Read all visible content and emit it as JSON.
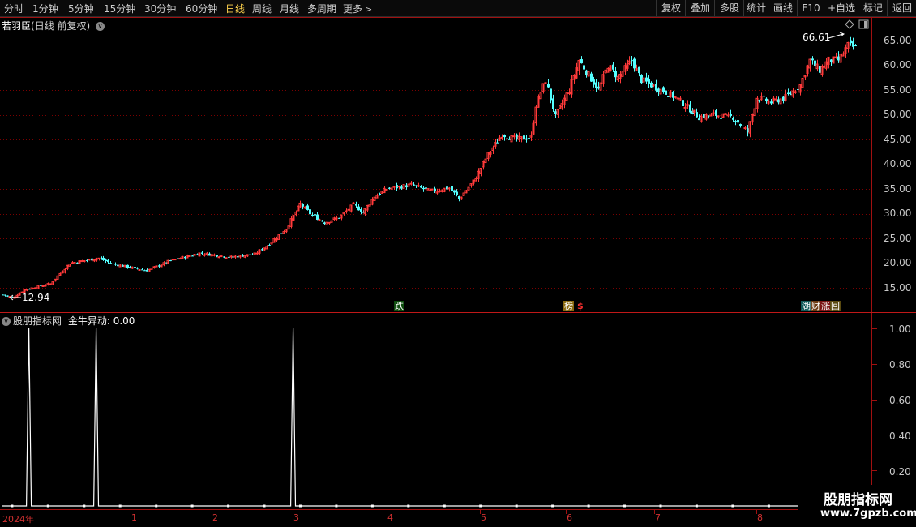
{
  "toolbar": {
    "timeframes": [
      "分时",
      "1分钟",
      "5分钟",
      "15分钟",
      "30分钟",
      "60分钟",
      "日线",
      "周线",
      "月线",
      "多周期",
      "更多"
    ],
    "active_timeframe": "日线",
    "buttons": [
      "复权",
      "叠加",
      "多股",
      "统计",
      "画线",
      "F10",
      "+自选",
      "返回"
    ]
  },
  "main_chart": {
    "stock_name": "若羽臣",
    "period_label": "(日线 前复权)",
    "y_ticks": [
      "65.00",
      "60.00",
      "55.00",
      "50.00",
      "45.00",
      "40.00",
      "35.00",
      "30.00",
      "25.00",
      "20.00",
      "15.00"
    ],
    "low_label": "12.94",
    "high_label": "66.61",
    "markers": [
      "跌",
      "榜",
      "$",
      "湖",
      "财",
      "涨",
      "回"
    ],
    "colors": {
      "up": "#ff3a3a",
      "down": "#54ffff",
      "grid": "#7a0000",
      "border": "#a01010"
    }
  },
  "indicator": {
    "name": "股朋指标网",
    "formula_label": "金牛异动: 0.00",
    "y_ticks": [
      "1.00",
      "0.80",
      "0.60",
      "0.40",
      "0.20"
    ],
    "signal_color": "#ffffff"
  },
  "x_axis": {
    "labels": [
      "2024年",
      "1",
      "2",
      "3",
      "4",
      "5",
      "6",
      "7",
      "8"
    ]
  },
  "watermark": {
    "line1": "股朋指标网",
    "line2": "www.7gpzb.com"
  },
  "chart_data": {
    "type": "candlestick",
    "y_unit": "price",
    "ylim": [
      11,
      67
    ],
    "low": 12.94,
    "high": 66.61,
    "anchors": [
      [
        0,
        13.6
      ],
      [
        3,
        13.2
      ],
      [
        4,
        12.94
      ],
      [
        9,
        14.6
      ],
      [
        14,
        15.2
      ],
      [
        20,
        15.8
      ],
      [
        28,
        20
      ],
      [
        40,
        21
      ],
      [
        46,
        19.8
      ],
      [
        60,
        18.5
      ],
      [
        70,
        20.5
      ],
      [
        82,
        22
      ],
      [
        95,
        21.2
      ],
      [
        105,
        21.8
      ],
      [
        110,
        23.5
      ],
      [
        118,
        27
      ],
      [
        124,
        32
      ],
      [
        128,
        30
      ],
      [
        134,
        28.2
      ],
      [
        140,
        29.2
      ],
      [
        146,
        31.8
      ],
      [
        150,
        30.2
      ],
      [
        155,
        33.5
      ],
      [
        160,
        35
      ],
      [
        170,
        35.8
      ],
      [
        178,
        34.5
      ],
      [
        186,
        35.2
      ],
      [
        190,
        33
      ],
      [
        196,
        36.5
      ],
      [
        202,
        42
      ],
      [
        208,
        46
      ],
      [
        214,
        45
      ],
      [
        220,
        45.5
      ],
      [
        222,
        52
      ],
      [
        226,
        57
      ],
      [
        230,
        49.5
      ],
      [
        236,
        55
      ],
      [
        240,
        61
      ],
      [
        244,
        58
      ],
      [
        248,
        55
      ],
      [
        252,
        60
      ],
      [
        256,
        57.5
      ],
      [
        262,
        61
      ],
      [
        266,
        57
      ],
      [
        272,
        55.5
      ],
      [
        280,
        53.5
      ],
      [
        290,
        49.5
      ],
      [
        296,
        50
      ],
      [
        304,
        49.5
      ],
      [
        310,
        46.5
      ],
      [
        314,
        53.5
      ],
      [
        320,
        52.5
      ],
      [
        326,
        53.5
      ],
      [
        332,
        56
      ],
      [
        336,
        61
      ],
      [
        340,
        59
      ],
      [
        344,
        61
      ],
      [
        348,
        61
      ],
      [
        352,
        64
      ],
      [
        355,
        63.5
      ]
    ],
    "indicator": {
      "type": "line",
      "spike_days": [
        11,
        39,
        121
      ],
      "spike_value": 1,
      "base_value": 0,
      "ylim": [
        0,
        1.05
      ]
    }
  }
}
